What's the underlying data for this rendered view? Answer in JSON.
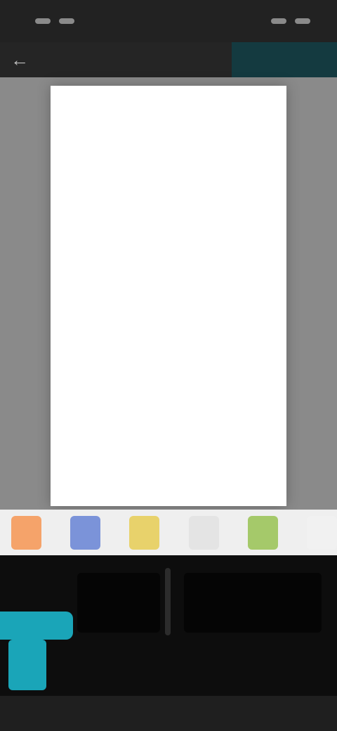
{
  "status_bar": {
    "time": "",
    "right": ""
  },
  "toolbar": {
    "back_icon": "back-arrow-icon",
    "title": "",
    "save_label": ""
  },
  "canvas": {
    "page_text": ""
  },
  "palette": {
    "colors": [
      "#f5a36a",
      "#7b93d9",
      "#e8d26b",
      "#e4e4e4",
      "#a5c96a",
      "#f1f1f1"
    ]
  },
  "tools": {
    "primary_label": ""
  },
  "accent": "#1aa5b8"
}
